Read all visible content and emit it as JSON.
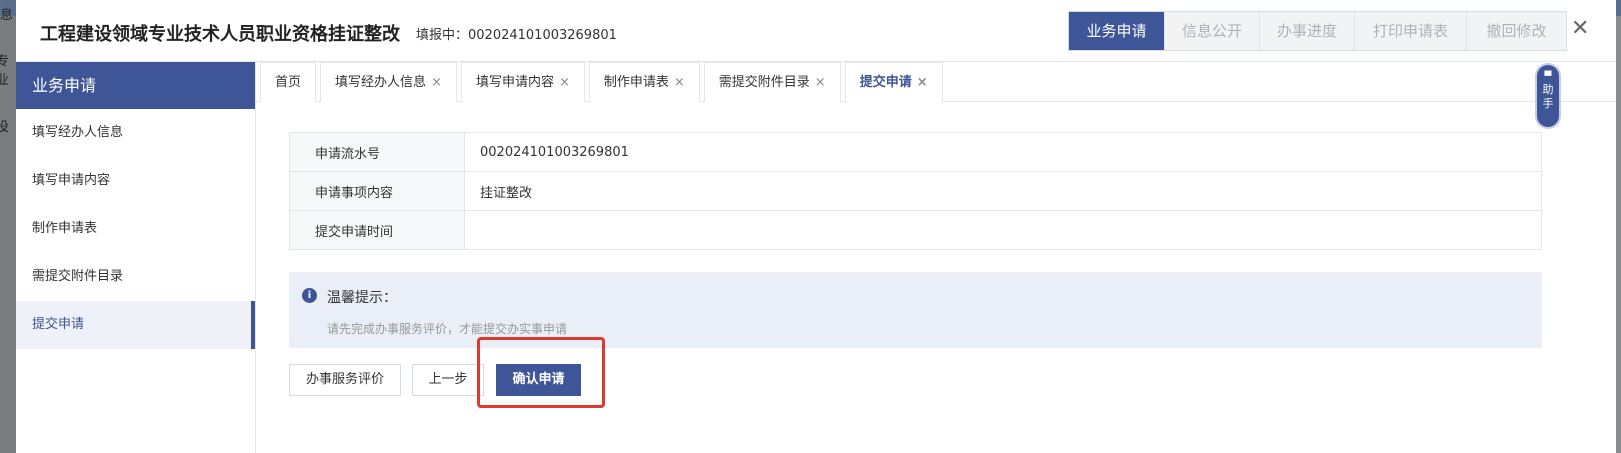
{
  "background": {
    "left_fragments": [
      "息",
      "专业",
      "没"
    ]
  },
  "header": {
    "title": "工程建设领域专业技术人员职业资格挂证整改",
    "serial_label": "填报中：002024101003269801",
    "top_tabs": [
      "业务申请",
      "信息公开",
      "办事进度",
      "打印申请表",
      "撤回修改"
    ],
    "close_symbol": "✕"
  },
  "sidebar": {
    "title": "业务申请",
    "items": [
      "填写经办人信息",
      "填写申请内容",
      "制作申请表",
      "需提交附件目录",
      "提交申请"
    ]
  },
  "tabs": [
    "首页",
    "填写经办人信息",
    "填写申请内容",
    "制作申请表",
    "需提交附件目录",
    "提交申请"
  ],
  "tab_close": "×",
  "info": {
    "rows": [
      {
        "label": "申请流水号",
        "value": "002024101003269801"
      },
      {
        "label": "申请事项内容",
        "value": "挂证整改"
      },
      {
        "label": "提交申请时间",
        "value": ""
      }
    ]
  },
  "notice": {
    "icon": "i",
    "title": "温馨提示：",
    "desc": "请先完成办事服务评价，才能提交办实事申请"
  },
  "buttons": {
    "eval": "办事服务评价",
    "prev": "上一步",
    "confirm": "确认申请"
  },
  "helper": {
    "icon": "▀",
    "chars": [
      "助",
      "手"
    ]
  },
  "colors": {
    "primary": "#3e5597",
    "highlight": "#e03a2f"
  }
}
